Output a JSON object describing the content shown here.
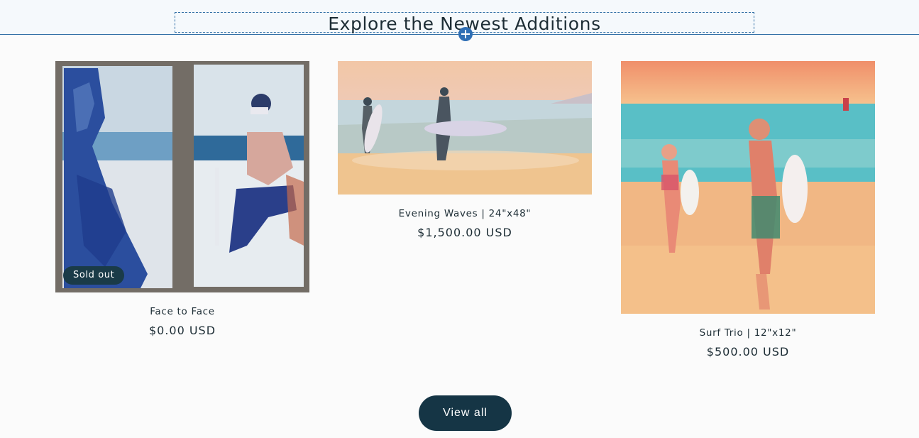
{
  "section": {
    "title": "Explore the Newest Additions"
  },
  "products": [
    {
      "title": "Face to Face",
      "price": "$0.00 USD",
      "badge": "Sold out"
    },
    {
      "title": "Evening Waves | 24\"x48\"",
      "price": "$1,500.00 USD"
    },
    {
      "title": "Surf Trio | 12\"x12\"",
      "price": "$500.00 USD"
    }
  ],
  "actions": {
    "view_all_label": "View all"
  },
  "icons": {
    "add_section": "plus-circle-icon"
  },
  "colors": {
    "accent": "#2f6fb5",
    "button": "#153545",
    "text": "#1d2d35"
  }
}
